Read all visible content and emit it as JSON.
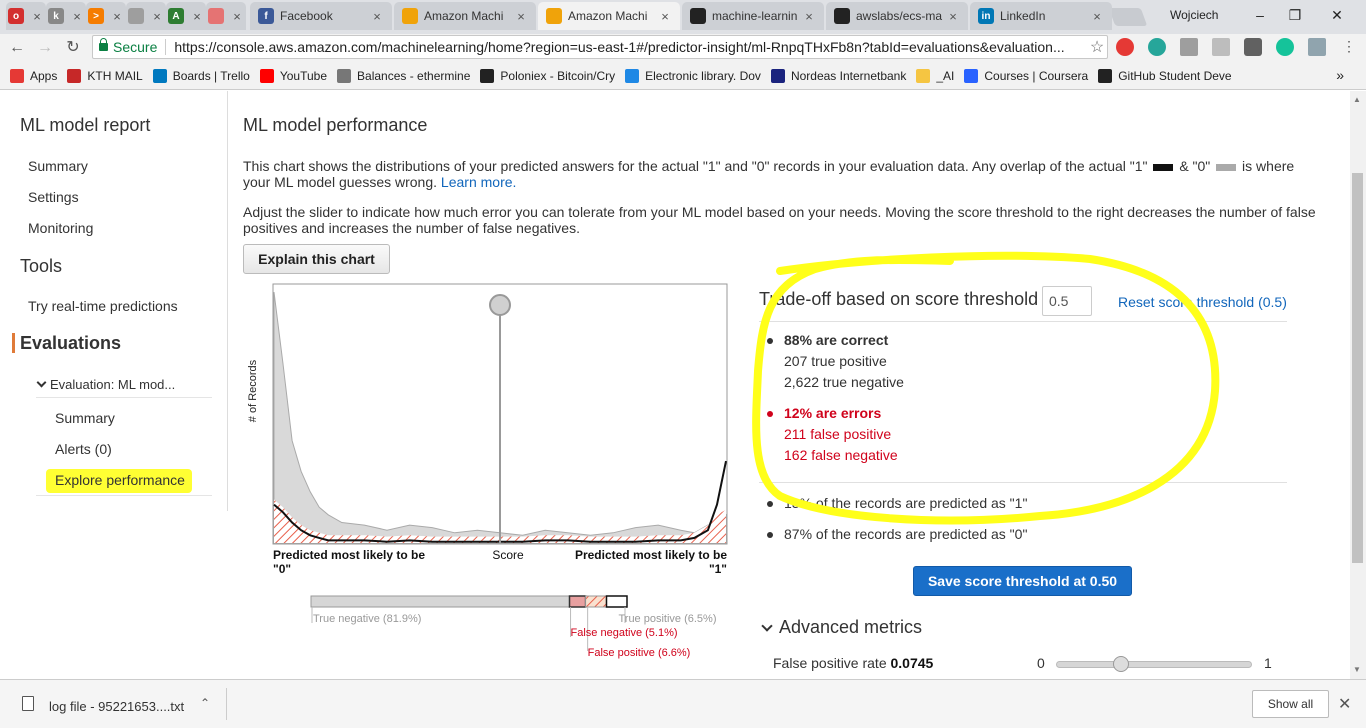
{
  "browser": {
    "tabs": [
      {
        "label": "",
        "color": "#d32f2f",
        "glyph": "o"
      },
      {
        "label": "",
        "color": "#888888",
        "glyph": "k"
      },
      {
        "label": "",
        "color": "#f57c00",
        "glyph": ">"
      },
      {
        "label": "",
        "color": "#9e9e9e",
        "glyph": ""
      },
      {
        "label": "",
        "color": "#2e7d32",
        "glyph": "A"
      },
      {
        "label": "",
        "color": "#e57373",
        "glyph": ""
      },
      {
        "label": "Facebook",
        "color": "#3b5998",
        "glyph": "f"
      },
      {
        "label": "Amazon Machi",
        "color": "#f0a30a",
        "glyph": ""
      },
      {
        "label": "Amazon Machi",
        "color": "#f0a30a",
        "glyph": ""
      },
      {
        "label": "machine-learnin",
        "color": "#222222",
        "glyph": ""
      },
      {
        "label": "awslabs/ecs-ma",
        "color": "#222222",
        "glyph": ""
      },
      {
        "label": "LinkedIn",
        "color": "#0077b5",
        "glyph": "in"
      }
    ],
    "user": "Wojciech",
    "secure_label": "Secure",
    "url": "https://console.aws.amazon.com/machinelearning/home?region=us-east-1#/predictor-insight/ml-RnpqTHxFb8n?tabId=evaluations&evaluation...",
    "bookmarks": [
      "Apps",
      "KTH MAIL",
      "Boards | Trello",
      "YouTube",
      "Balances - ethermine",
      "Poloniex - Bitcoin/Cry",
      "Electronic library. Dov",
      "Nordeas Internetbank",
      "_AI",
      "Courses | Coursera",
      "GitHub Student Deve"
    ],
    "bookmark_colors": [
      "#e53935",
      "#c62828",
      "#0079bf",
      "#ff0000",
      "#777777",
      "#222222",
      "#1e88e5",
      "#1a237e",
      "#f5c542",
      "#2962ff",
      "#222222"
    ],
    "more": "»"
  },
  "sidenav": {
    "report_title": "ML model report",
    "summary": "Summary",
    "settings": "Settings",
    "monitoring": "Monitoring",
    "tools_title": "Tools",
    "realtime": "Try real-time predictions",
    "evaluations": "Evaluations",
    "evaluation_item": "Evaluation: ML mod...",
    "eval_summary": "Summary",
    "alerts": "Alerts (0)",
    "explore": "Explore performance"
  },
  "main": {
    "title": "ML model performance",
    "para1_a": "This chart shows the distributions of your predicted answers for the actual \"1\" and \"0\" records in your evaluation data. Any overlap of the actual \"1\"",
    "para1_b": "& \"0\"",
    "para1_c": "is where your ML model guesses wrong.",
    "learn_more": "Learn more.",
    "para2": "Adjust the slider to indicate how much error you can tolerate from your ML model based on your needs. Moving the score threshold to the right decreases the number of false positives and increases the number of false negatives.",
    "explain_button": "Explain this chart"
  },
  "chart_data": {
    "type": "area",
    "ylabel": "# of Records",
    "xlabel": "Score",
    "x_left_label": "Predicted most likely to be \"0\"",
    "x_right_label": "Predicted most likely to be \"1\"",
    "threshold": 0.5,
    "x": [
      0.0,
      0.02,
      0.04,
      0.06,
      0.08,
      0.1,
      0.12,
      0.15,
      0.2,
      0.25,
      0.3,
      0.35,
      0.4,
      0.45,
      0.5,
      0.55,
      0.6,
      0.65,
      0.7,
      0.75,
      0.8,
      0.85,
      0.9,
      0.93,
      0.96,
      0.98,
      1.0
    ],
    "series": [
      {
        "name": "\"0\"",
        "color": "#aaaaaa",
        "values": [
          98,
          70,
          40,
          28,
          20,
          14,
          11,
          8,
          7,
          5,
          7,
          6,
          4,
          5,
          4,
          3,
          5,
          4,
          3,
          4,
          6,
          7,
          5,
          4,
          7,
          9,
          11
        ]
      },
      {
        "name": "\"1\"",
        "color": "#111111",
        "values": [
          15,
          12,
          8,
          5,
          3,
          2,
          1,
          1,
          1,
          0.5,
          1,
          0.5,
          0.5,
          0.5,
          0.5,
          0.5,
          1,
          1,
          0.5,
          0.5,
          0.5,
          1,
          1,
          2,
          5,
          15,
          32
        ]
      }
    ],
    "ylim": [
      0,
      100
    ]
  },
  "distribution": {
    "true_negative_pct": 81.9,
    "false_negative_pct": 5.1,
    "false_positive_pct": 6.6,
    "true_positive_pct": 6.5,
    "true_negative_label": "True negative (81.9%)",
    "false_negative_label": "False negative (5.1%)",
    "false_positive_label": "False positive (6.6%)",
    "true_positive_label": "True positive (6.5%)"
  },
  "tradeoff": {
    "title": "Trade-off based on score threshold",
    "threshold_value": "0.5",
    "reset_link": "Reset score threshold (0.5)",
    "correct_heading": "88% are correct",
    "true_positive": "207 true positive",
    "true_negative": "2,622 true negative",
    "errors_heading": "12% are errors",
    "false_positive": "211 false positive",
    "false_negative": "162 false negative",
    "predicted_1": "13% of the records are predicted as \"1\"",
    "predicted_0": "87% of the records are predicted as \"0\"",
    "save_button": "Save score threshold at 0.50",
    "advanced": "Advanced metrics",
    "fpr_label": "False positive rate",
    "fpr_value": "0.0745",
    "fpr_min": "0",
    "fpr_max": "1",
    "fpr_slider": 0.33
  },
  "download": {
    "filename": "log file - 95221653....txt",
    "show_all": "Show all"
  },
  "colors": {
    "accent_link": "#1166bb",
    "error_red": "#d0021b",
    "primary_button": "#1a6fc9",
    "highlight_yellow": "#ffff33",
    "active_marker": "#e07b39"
  }
}
